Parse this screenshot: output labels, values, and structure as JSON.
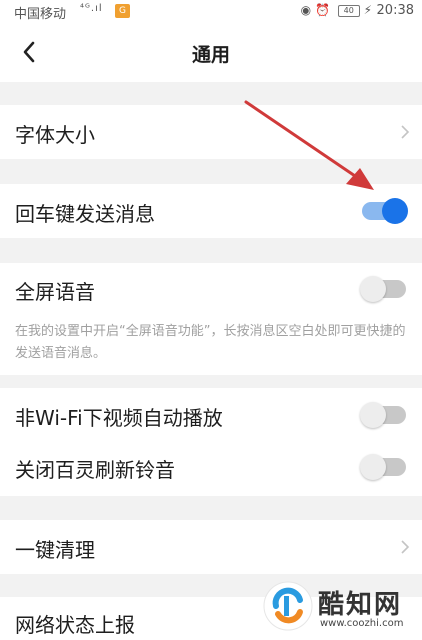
{
  "status_bar": {
    "carrier": "中国移动",
    "signal": "⁴ᴳ.ıl",
    "app_badge": "G",
    "battery": "40",
    "time": "20:38"
  },
  "header": {
    "title": "通用"
  },
  "settings": {
    "font_size": {
      "label": "字体大小"
    },
    "enter_send": {
      "label": "回车键发送消息",
      "enabled": true
    },
    "fullscreen_voice": {
      "label": "全屏语音",
      "enabled": false
    },
    "fullscreen_voice_hint": "在我的设置中开启“全屏语音功能”，长按消息区空白处即可更快捷的发送语音消息。",
    "non_wifi_autoplay": {
      "label": "非Wi-Fi下视频自动播放",
      "enabled": false
    },
    "close_ringtone": {
      "label": "关闭百灵刷新铃音",
      "enabled": false
    },
    "one_key_clean": {
      "label": "一键清理"
    },
    "network_report": {
      "label": "网络状态上报"
    }
  },
  "watermark": {
    "brand": "酷知网",
    "url": "www.coozhi.com"
  },
  "colors": {
    "toggle_on": "#1a73e8",
    "toggle_off": "#c8c8c8",
    "annotation_arrow": "#d03a3a",
    "background": "#f2f2f2"
  }
}
